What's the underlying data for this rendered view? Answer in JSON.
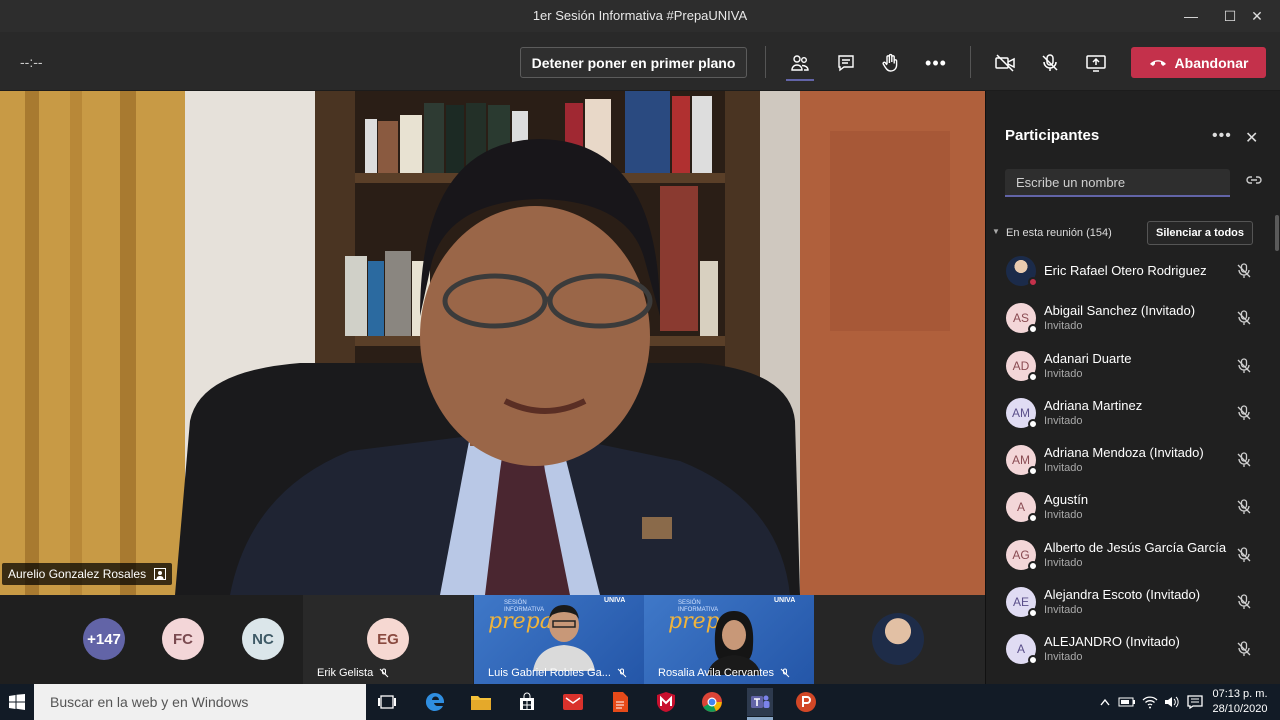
{
  "window": {
    "title": "1er Sesión Informativa #PrepaUNIVA",
    "minimize_icon": "—",
    "maximize_icon": "☐",
    "close_icon": "✕"
  },
  "toolbar": {
    "timer": "--:--",
    "stop_spotlight_label": "Detener poner en primer plano",
    "leave_label": "Abandonar",
    "leave_color": "#c4314b",
    "accent_color": "#6264a7"
  },
  "main_video": {
    "speaker_name": "Aurelio Gonzalez Rosales"
  },
  "panel": {
    "title": "Participantes",
    "more_icon": "•••",
    "close_icon": "✕",
    "search_placeholder": "Escribe un nombre",
    "section_label": "En esta reunión (154)",
    "mute_all_label": "Silenciar a todos",
    "participants": [
      {
        "initials": "",
        "name": "Eric Rafael Otero Rodriguez",
        "sub": "",
        "avatar": "photo"
      },
      {
        "initials": "AS",
        "name": "Abigail Sanchez (Invitado)",
        "sub": "Invitado",
        "avatar": "pink"
      },
      {
        "initials": "AD",
        "name": "Adanari Duarte",
        "sub": "Invitado",
        "avatar": "pink"
      },
      {
        "initials": "AM",
        "name": "Adriana Martinez",
        "sub": "Invitado",
        "avatar": "lav"
      },
      {
        "initials": "AM",
        "name": "Adriana Mendoza (Invitado)",
        "sub": "Invitado",
        "avatar": "pink"
      },
      {
        "initials": "A",
        "name": "Agustín",
        "sub": "Invitado",
        "avatar": "pink"
      },
      {
        "initials": "AG",
        "name": "Alberto de Jesús García García",
        "sub": "Invitado",
        "avatar": "pink"
      },
      {
        "initials": "AE",
        "name": "Alejandra Escoto (Invitado)",
        "sub": "Invitado",
        "avatar": "lav"
      },
      {
        "initials": "A",
        "name": "ALEJANDRO (Invitado)",
        "sub": "Invitado",
        "avatar": "lav"
      }
    ]
  },
  "gallery": {
    "overflow": "+147",
    "fc": "FC",
    "nc": "NC",
    "eg": "EG",
    "eg_name": "Erik Gelista",
    "tile1_name": "Luis Gabriel Robles Ga...",
    "tile2_name": "Rosalia Avila Cervantes",
    "brand": "UNIVA",
    "banner_line1": "SESIÓN",
    "banner_line2": "INFORMATIVA",
    "banner_word": "prepa"
  },
  "taskbar": {
    "search_placeholder": "Buscar en la web y en Windows",
    "time": "07:13 p. m.",
    "date": "28/10/2020"
  }
}
